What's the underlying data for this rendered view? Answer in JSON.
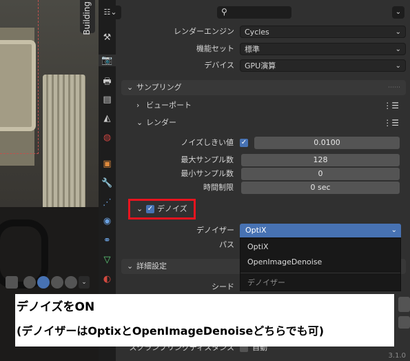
{
  "viewport": {
    "tab_label": "Building"
  },
  "header": {
    "editor_type_icon": "properties-editor-icon",
    "search_icon": "search-icon"
  },
  "render": {
    "engine_label": "レンダーエンジン",
    "engine_value": "Cycles",
    "feature_set_label": "機能セット",
    "feature_set_value": "標準",
    "device_label": "デバイス",
    "device_value": "GPU演算"
  },
  "sampling": {
    "title": "サンプリング",
    "viewport_title": "ビューポート",
    "render_title": "レンダー",
    "noise_threshold_label": "ノイズしきい値",
    "noise_threshold_value": "0.0100",
    "noise_threshold_enabled": true,
    "max_samples_label": "最大サンプル数",
    "max_samples_value": "128",
    "min_samples_label": "最小サンプル数",
    "min_samples_value": "0",
    "time_limit_label": "時間制限",
    "time_limit_value": "0 sec",
    "denoise_title": "デノイズ",
    "denoise_enabled": true,
    "denoiser_label": "デノイザー",
    "denoiser_value": "OptiX",
    "pass_label": "パス",
    "denoiser_options": [
      "OptiX",
      "OpenImageDenoise"
    ],
    "denoiser_popup_title": "デノイザー"
  },
  "advanced": {
    "title": "詳細設定",
    "seed_label": "シード",
    "scramble_label": "スクランブリングディスタンス",
    "scramble_value": "自動"
  },
  "annotation": {
    "line1": "デノイズをON",
    "line2": "(デノイザーはOptixとOpenImageDenoiseどちらでも可)",
    "highlight_color": "#e8141f"
  },
  "status": {
    "version": "3.1.0"
  },
  "colors": {
    "accent": "#4772b3",
    "panel_bg": "#303030",
    "sidebar_bg": "#1d1d1d"
  }
}
